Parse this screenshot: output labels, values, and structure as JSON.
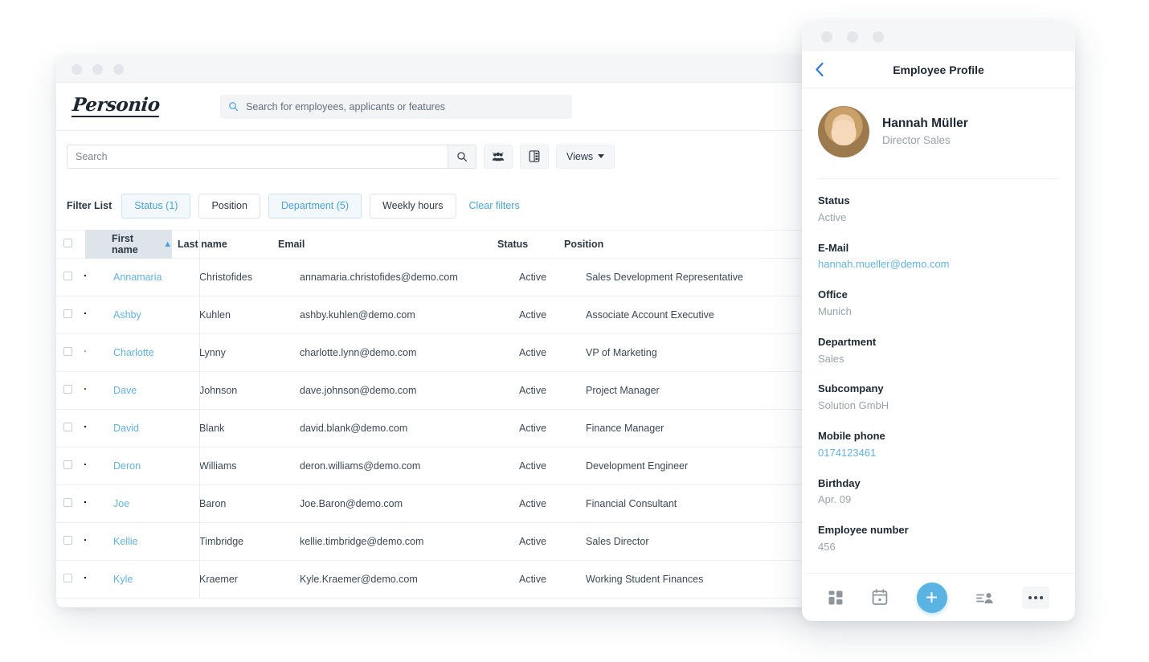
{
  "desktop": {
    "window_dots": [
      "dot-1",
      "dot-2",
      "dot-3"
    ],
    "logo_text": "Personio",
    "global_search": {
      "icon": "search-icon",
      "placeholder": "Search for employees, applicants or features",
      "value": ""
    },
    "toolbar": {
      "search_placeholder": "Search",
      "search_value": "",
      "search_button_icon": "search-icon",
      "group_button_icon": "people-group-icon",
      "columns_button_icon": "columns-layout-icon",
      "views_label": "Views",
      "views_caret_icon": "chevron-down-icon"
    },
    "filters": {
      "label": "Filter List",
      "chips": [
        {
          "label": "Status (1)",
          "active": true
        },
        {
          "label": "Position",
          "active": false
        },
        {
          "label": "Department (5)",
          "active": true
        },
        {
          "label": "Weekly hours",
          "active": false
        }
      ],
      "clear_label": "Clear filters"
    },
    "table": {
      "columns": [
        "First name",
        "Last name",
        "Email",
        "Status",
        "Position"
      ],
      "sorted_column": "First name",
      "sort_direction_icon": "sort-ascending-arrow",
      "rows": [
        {
          "first": "Annamaria",
          "last": "Christofides",
          "email": "annamaria.christofides@demo.com",
          "status": "Active",
          "position": "Sales Development Representative",
          "hair": "#2a2119",
          "skin": "#c98f68",
          "shirt": "#4c5a68"
        },
        {
          "first": "Ashby",
          "last": "Kuhlen",
          "email": "ashby.kuhlen@demo.com",
          "status": "Active",
          "position": "Associate Account Executive",
          "hair": "#2b2018",
          "skin": "#b9805c",
          "shirt": "#3f6c9e"
        },
        {
          "first": "Charlotte",
          "last": "Lynny",
          "email": "charlotte.lynn@demo.com",
          "status": "Active",
          "position": "VP of Marketing",
          "hair": "#c8a878",
          "skin": "#f0cdae",
          "shirt": "#e3e6ea"
        },
        {
          "first": "Dave",
          "last": "Johnson",
          "email": "dave.johnson@demo.com",
          "status": "Active",
          "position": "Project Manager",
          "hair": "#6b5436",
          "skin": "#d9a97f",
          "shirt": "#2d3743"
        },
        {
          "first": "David",
          "last": "Blank",
          "email": "david.blank@demo.com",
          "status": "Active",
          "position": "Finance Manager",
          "hair": "#191513",
          "skin": "#8d6244",
          "shirt": "#dfe3e7"
        },
        {
          "first": "Deron",
          "last": "Williams",
          "email": "deron.williams@demo.com",
          "status": "Active",
          "position": "Development Engineer",
          "hair": "#3a2a1c",
          "skin": "#8a5f3c",
          "shirt": "#6b4f33"
        },
        {
          "first": "Joe",
          "last": "Baron",
          "email": "Joe.Baron@demo.com",
          "status": "Active",
          "position": "Financial Consultant",
          "hair": "#140f0c",
          "skin": "#5e4130",
          "shirt": "#1b1714"
        },
        {
          "first": "Kellie",
          "last": "Timbridge",
          "email": "kellie.timbridge@demo.com",
          "status": "Active",
          "position": "Sales Director",
          "hair": "#2e2219",
          "skin": "#e0b48e",
          "shirt": "#c6ccd2"
        },
        {
          "first": "Kyle",
          "last": "Kraemer",
          "email": "Kyle.Kraemer@demo.com",
          "status": "Active",
          "position": "Working Student Finances",
          "hair": "#201a15",
          "skin": "#9c6f4e",
          "shirt": "#9aa3ab"
        }
      ]
    }
  },
  "mobile": {
    "window_dots": [
      "dot-1",
      "dot-2",
      "dot-3"
    ],
    "back_icon": "chevron-left-icon",
    "title": "Employee Profile",
    "profile": {
      "name": "Hannah Müller",
      "role": "Director Sales"
    },
    "fields": [
      {
        "label": "Status",
        "value": "Active",
        "is_link": false
      },
      {
        "label": "E-Mail",
        "value": "hannah.mueller@demo.com",
        "is_link": true
      },
      {
        "label": "Office",
        "value": "Munich",
        "is_link": false
      },
      {
        "label": "Department",
        "value": "Sales",
        "is_link": false
      },
      {
        "label": "Subcompany",
        "value": "Solution GmbH",
        "is_link": false
      },
      {
        "label": "Mobile phone",
        "value": "0174123461",
        "is_link": true
      },
      {
        "label": "Birthday",
        "value": "Apr. 09",
        "is_link": false
      },
      {
        "label": "Employee number",
        "value": "456",
        "is_link": false
      }
    ],
    "nav": [
      {
        "icon": "dashboard-grid-icon"
      },
      {
        "icon": "calendar-icon"
      },
      {
        "icon": "plus-icon"
      },
      {
        "icon": "person-list-icon"
      },
      {
        "icon": "more-ellipsis-icon"
      }
    ]
  },
  "colors": {
    "accent_blue": "#4aa3df",
    "link_blue": "#62b2e3",
    "fab_blue": "#5bb3e4",
    "text_dark": "#1d2731",
    "text_muted": "#9aa3ac"
  }
}
